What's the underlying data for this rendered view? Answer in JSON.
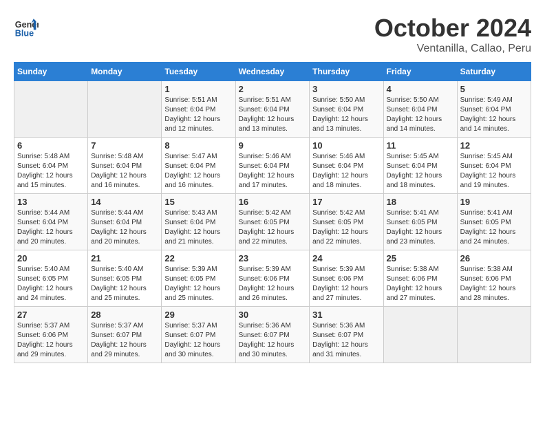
{
  "header": {
    "logo_general": "General",
    "logo_blue": "Blue",
    "title": "October 2024",
    "subtitle": "Ventanilla, Callao, Peru"
  },
  "weekdays": [
    "Sunday",
    "Monday",
    "Tuesday",
    "Wednesday",
    "Thursday",
    "Friday",
    "Saturday"
  ],
  "weeks": [
    [
      {
        "day": "",
        "empty": true
      },
      {
        "day": "",
        "empty": true
      },
      {
        "day": "1",
        "sunrise": "Sunrise: 5:51 AM",
        "sunset": "Sunset: 6:04 PM",
        "daylight": "Daylight: 12 hours and 12 minutes."
      },
      {
        "day": "2",
        "sunrise": "Sunrise: 5:51 AM",
        "sunset": "Sunset: 6:04 PM",
        "daylight": "Daylight: 12 hours and 13 minutes."
      },
      {
        "day": "3",
        "sunrise": "Sunrise: 5:50 AM",
        "sunset": "Sunset: 6:04 PM",
        "daylight": "Daylight: 12 hours and 13 minutes."
      },
      {
        "day": "4",
        "sunrise": "Sunrise: 5:50 AM",
        "sunset": "Sunset: 6:04 PM",
        "daylight": "Daylight: 12 hours and 14 minutes."
      },
      {
        "day": "5",
        "sunrise": "Sunrise: 5:49 AM",
        "sunset": "Sunset: 6:04 PM",
        "daylight": "Daylight: 12 hours and 14 minutes."
      }
    ],
    [
      {
        "day": "6",
        "sunrise": "Sunrise: 5:48 AM",
        "sunset": "Sunset: 6:04 PM",
        "daylight": "Daylight: 12 hours and 15 minutes."
      },
      {
        "day": "7",
        "sunrise": "Sunrise: 5:48 AM",
        "sunset": "Sunset: 6:04 PM",
        "daylight": "Daylight: 12 hours and 16 minutes."
      },
      {
        "day": "8",
        "sunrise": "Sunrise: 5:47 AM",
        "sunset": "Sunset: 6:04 PM",
        "daylight": "Daylight: 12 hours and 16 minutes."
      },
      {
        "day": "9",
        "sunrise": "Sunrise: 5:46 AM",
        "sunset": "Sunset: 6:04 PM",
        "daylight": "Daylight: 12 hours and 17 minutes."
      },
      {
        "day": "10",
        "sunrise": "Sunrise: 5:46 AM",
        "sunset": "Sunset: 6:04 PM",
        "daylight": "Daylight: 12 hours and 18 minutes."
      },
      {
        "day": "11",
        "sunrise": "Sunrise: 5:45 AM",
        "sunset": "Sunset: 6:04 PM",
        "daylight": "Daylight: 12 hours and 18 minutes."
      },
      {
        "day": "12",
        "sunrise": "Sunrise: 5:45 AM",
        "sunset": "Sunset: 6:04 PM",
        "daylight": "Daylight: 12 hours and 19 minutes."
      }
    ],
    [
      {
        "day": "13",
        "sunrise": "Sunrise: 5:44 AM",
        "sunset": "Sunset: 6:04 PM",
        "daylight": "Daylight: 12 hours and 20 minutes."
      },
      {
        "day": "14",
        "sunrise": "Sunrise: 5:44 AM",
        "sunset": "Sunset: 6:04 PM",
        "daylight": "Daylight: 12 hours and 20 minutes."
      },
      {
        "day": "15",
        "sunrise": "Sunrise: 5:43 AM",
        "sunset": "Sunset: 6:04 PM",
        "daylight": "Daylight: 12 hours and 21 minutes."
      },
      {
        "day": "16",
        "sunrise": "Sunrise: 5:42 AM",
        "sunset": "Sunset: 6:05 PM",
        "daylight": "Daylight: 12 hours and 22 minutes."
      },
      {
        "day": "17",
        "sunrise": "Sunrise: 5:42 AM",
        "sunset": "Sunset: 6:05 PM",
        "daylight": "Daylight: 12 hours and 22 minutes."
      },
      {
        "day": "18",
        "sunrise": "Sunrise: 5:41 AM",
        "sunset": "Sunset: 6:05 PM",
        "daylight": "Daylight: 12 hours and 23 minutes."
      },
      {
        "day": "19",
        "sunrise": "Sunrise: 5:41 AM",
        "sunset": "Sunset: 6:05 PM",
        "daylight": "Daylight: 12 hours and 24 minutes."
      }
    ],
    [
      {
        "day": "20",
        "sunrise": "Sunrise: 5:40 AM",
        "sunset": "Sunset: 6:05 PM",
        "daylight": "Daylight: 12 hours and 24 minutes."
      },
      {
        "day": "21",
        "sunrise": "Sunrise: 5:40 AM",
        "sunset": "Sunset: 6:05 PM",
        "daylight": "Daylight: 12 hours and 25 minutes."
      },
      {
        "day": "22",
        "sunrise": "Sunrise: 5:39 AM",
        "sunset": "Sunset: 6:05 PM",
        "daylight": "Daylight: 12 hours and 25 minutes."
      },
      {
        "day": "23",
        "sunrise": "Sunrise: 5:39 AM",
        "sunset": "Sunset: 6:06 PM",
        "daylight": "Daylight: 12 hours and 26 minutes."
      },
      {
        "day": "24",
        "sunrise": "Sunrise: 5:39 AM",
        "sunset": "Sunset: 6:06 PM",
        "daylight": "Daylight: 12 hours and 27 minutes."
      },
      {
        "day": "25",
        "sunrise": "Sunrise: 5:38 AM",
        "sunset": "Sunset: 6:06 PM",
        "daylight": "Daylight: 12 hours and 27 minutes."
      },
      {
        "day": "26",
        "sunrise": "Sunrise: 5:38 AM",
        "sunset": "Sunset: 6:06 PM",
        "daylight": "Daylight: 12 hours and 28 minutes."
      }
    ],
    [
      {
        "day": "27",
        "sunrise": "Sunrise: 5:37 AM",
        "sunset": "Sunset: 6:06 PM",
        "daylight": "Daylight: 12 hours and 29 minutes."
      },
      {
        "day": "28",
        "sunrise": "Sunrise: 5:37 AM",
        "sunset": "Sunset: 6:07 PM",
        "daylight": "Daylight: 12 hours and 29 minutes."
      },
      {
        "day": "29",
        "sunrise": "Sunrise: 5:37 AM",
        "sunset": "Sunset: 6:07 PM",
        "daylight": "Daylight: 12 hours and 30 minutes."
      },
      {
        "day": "30",
        "sunrise": "Sunrise: 5:36 AM",
        "sunset": "Sunset: 6:07 PM",
        "daylight": "Daylight: 12 hours and 30 minutes."
      },
      {
        "day": "31",
        "sunrise": "Sunrise: 5:36 AM",
        "sunset": "Sunset: 6:07 PM",
        "daylight": "Daylight: 12 hours and 31 minutes."
      },
      {
        "day": "",
        "empty": true
      },
      {
        "day": "",
        "empty": true
      }
    ]
  ]
}
